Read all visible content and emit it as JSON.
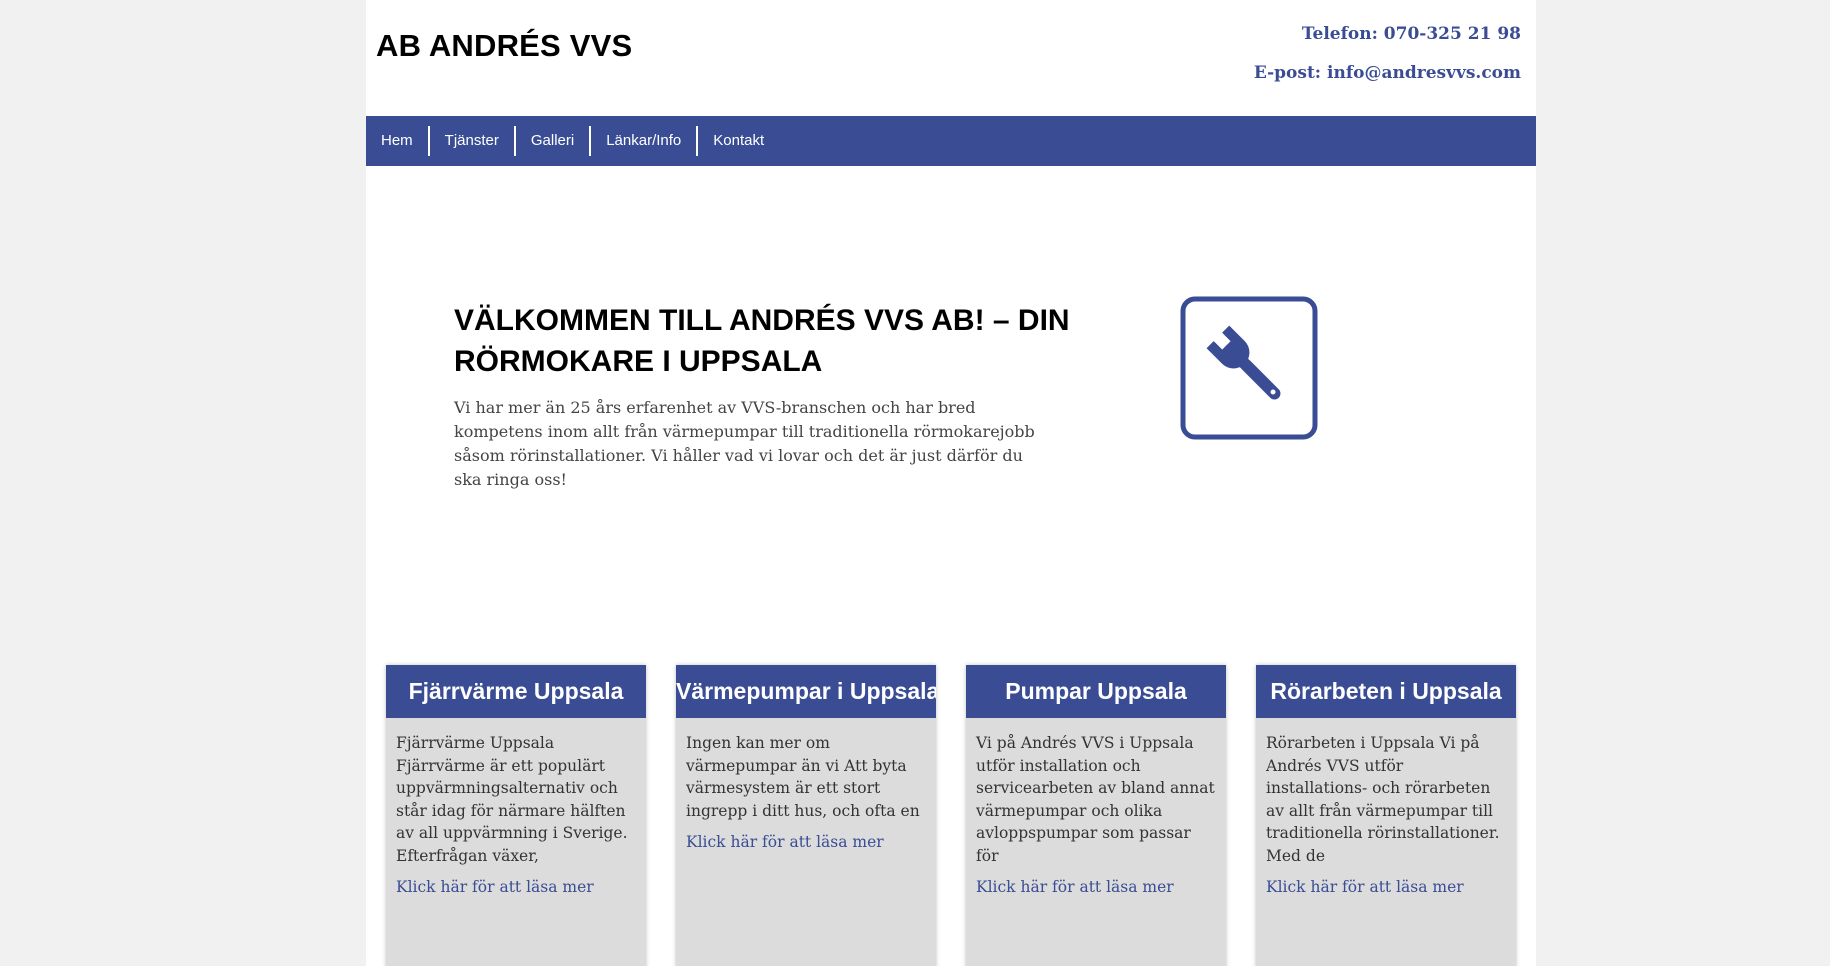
{
  "header": {
    "site_title": "AB ANDRÉS VVS",
    "phone": "Telefon: 070-325 21 98",
    "email": "E-post: info@andresvvs.com"
  },
  "nav": {
    "items": [
      {
        "label": "Hem"
      },
      {
        "label": "Tjänster"
      },
      {
        "label": "Galleri"
      },
      {
        "label": "Länkar/Info"
      },
      {
        "label": "Kontakt"
      }
    ]
  },
  "hero": {
    "title": "VÄLKOMMEN TILL ANDRÉS VVS AB! – DIN RÖRMOKARE I UPPSALA",
    "text": "Vi har mer än 25 års erfarenhet av VVS-branschen och har bred kompetens inom allt från värmepumpar till traditionella rörmokarejobb såsom rörinstallationer. Vi håller vad vi lovar och det är just därför du ska ringa oss!",
    "icon": "wrench-icon"
  },
  "cards": [
    {
      "title": "Fjärrvärme Uppsala",
      "text": "Fjärrvärme Uppsala Fjärrvärme är ett populärt uppvärmningsalternativ och står idag för närmare hälften av all uppvärmning i Sverige. Efterfrågan växer,",
      "link": "Klick här för att läsa mer"
    },
    {
      "title": "Värmepumpar i Uppsala",
      "text": "Ingen kan mer om värmepumpar än vi Att byta värmesystem är ett stort ingrepp i ditt hus, och ofta en",
      "link": "Klick här för att läsa mer"
    },
    {
      "title": "Pumpar Uppsala",
      "text": "Vi på Andrés VVS i Uppsala utför installation och servicearbeten av bland annat värmepumpar och olika avloppspumpar som passar för",
      "link": "Klick här för att läsa mer"
    },
    {
      "title": "Rörarbeten i Uppsala",
      "text": "Rörarbeten i Uppsala Vi på Andrés VVS utför installations- och rörarbeten av allt från värmepumpar till traditionella rörinstallationer. Med de",
      "link": "Klick här för att läsa mer"
    }
  ],
  "colors": {
    "brand": "#3a4d94",
    "card_background": "#dcdcdc",
    "page_background": "#f1f1f1"
  }
}
